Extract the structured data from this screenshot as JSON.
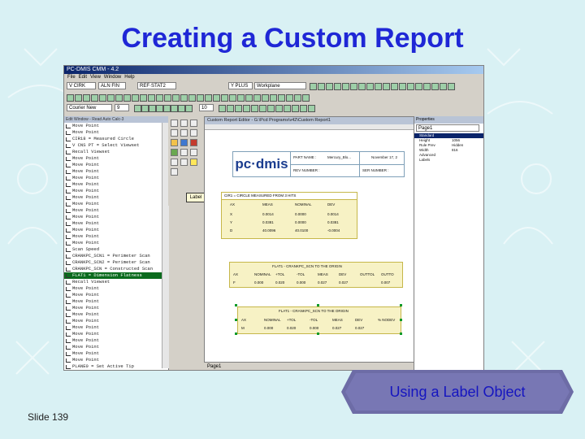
{
  "slide": {
    "title": "Creating a Custom Report",
    "callout": "Using a Label Object",
    "number": "Slide 139"
  },
  "app": {
    "window_title": "PC-DMIS CMM - 4.2",
    "menu": [
      "File",
      "Edit",
      "View",
      "Window",
      "Help"
    ],
    "combo1": "V CIRK",
    "combo2": "ALN FIN",
    "combo3": "REF·STAT2",
    "combo4": "Y PLUS",
    "combo5": "Workplane",
    "font_combo": "Courier New",
    "size_combo": "9",
    "zoom_combo": "10"
  },
  "edit_window": {
    "title": "Edit Window - Read Auto Calc-3",
    "lines": [
      {
        "text": "Move Point",
        "selected": false
      },
      {
        "text": "Move Point",
        "selected": false
      },
      {
        "text": "CIR18 = Measured Circle",
        "selected": false
      },
      {
        "text": "V CNS PT = Select Viewset",
        "selected": false
      },
      {
        "text": "Recall Viewset",
        "selected": false
      },
      {
        "text": "Move Point",
        "selected": false
      },
      {
        "text": "Move Point",
        "selected": false
      },
      {
        "text": "Move Point",
        "selected": false
      },
      {
        "text": "Move Point",
        "selected": false
      },
      {
        "text": "Move Point",
        "selected": false
      },
      {
        "text": "Move Point",
        "selected": false
      },
      {
        "text": "Move Point",
        "selected": false
      },
      {
        "text": "Move Point",
        "selected": false
      },
      {
        "text": "Move Point",
        "selected": false
      },
      {
        "text": "Move Point",
        "selected": false
      },
      {
        "text": "Move Point",
        "selected": false
      },
      {
        "text": "Move Point",
        "selected": false
      },
      {
        "text": "Move Point",
        "selected": false
      },
      {
        "text": "Move Point",
        "selected": false
      },
      {
        "text": "Scan Speed",
        "selected": false
      },
      {
        "text": "CRANKPC_SCN1 = Perimeter Scan",
        "selected": false
      },
      {
        "text": "CRANKPC_SCN2 = Perimeter Scan",
        "selected": false
      },
      {
        "text": "CRANKPC_SCN = Constructed Scan",
        "selected": false
      },
      {
        "text": "FLAT1 = Dimension Flatness",
        "selected": true
      },
      {
        "text": "Recall Viewset",
        "selected": false
      },
      {
        "text": "Move Point",
        "selected": false
      },
      {
        "text": "Move Point",
        "selected": false
      },
      {
        "text": "Move Point",
        "selected": false
      },
      {
        "text": "Move Point",
        "selected": false
      },
      {
        "text": "Move Point",
        "selected": false
      },
      {
        "text": "Move Point",
        "selected": false
      },
      {
        "text": "Move Point",
        "selected": false
      },
      {
        "text": "Move Point",
        "selected": false
      },
      {
        "text": "Move Point",
        "selected": false
      },
      {
        "text": "Move Point",
        "selected": false
      },
      {
        "text": "Move Point",
        "selected": false
      },
      {
        "text": "Move Point",
        "selected": false
      },
      {
        "text": "PLANE0 = Set Active Tip",
        "selected": false
      },
      {
        "text": "Set Active Workplane",
        "selected": false
      },
      {
        "text": "Move Point",
        "selected": false
      }
    ]
  },
  "report": {
    "title": "Custom Report Editor - G:\\Pcd Programs\\v42\\Custom Report1",
    "logo": "pc·dmis",
    "part_name_label": "PART NAME :",
    "part_name_value": "Mercury_Blo...",
    "date_value": "November 17, 2",
    "rev_label": "REV NUMBER :",
    "ser_label": "SER NUMBER :",
    "cir_title": "CIR1 = CIRCLE MEASURED FROM 3 HITS",
    "cir_headers": [
      "AX",
      "MEAS",
      "NOMINAL",
      "DEV"
    ],
    "cir_rows": [
      [
        "X",
        "0.0014",
        "0.0000",
        "0.0014"
      ],
      [
        "Y",
        "0.0381",
        "0.0000",
        "0.0381"
      ],
      [
        "D",
        "40.0096",
        "40.0100",
        "-0.0004"
      ]
    ],
    "flat1_title": "FLAT1 - CRANKPC_SCN TO THE ORIGIN",
    "flat1_headers": [
      "AX",
      "NOMINAL",
      "+TOL",
      "-TOL",
      "MEAS",
      "DEV",
      "OUTTOL",
      "OUTTO"
    ],
    "flat1_row": [
      "F",
      "0.000",
      "0.020",
      "0.000",
      "0.027",
      "0.027",
      "",
      "0.007"
    ],
    "flat2_title": "FLAT1 - CRANKPC_SCN TO THE ORIGIN",
    "flat2_headers": [
      "AX",
      "NOMINAL",
      "+TOL",
      "-TOL",
      "MEAS",
      "DEV",
      "% NODEV"
    ],
    "flat2_row": [
      "M",
      "0.000",
      "0.020",
      "0.000",
      "0.027",
      "0.027",
      ""
    ],
    "label_tool": "Label",
    "page_tab": "Page1"
  },
  "properties": {
    "title": "Properties",
    "combo": "Page1",
    "section": "Standard",
    "rows": [
      {
        "k": "Height",
        "v": "1056"
      },
      {
        "k": "Rule Prev",
        "v": "Hidden"
      },
      {
        "k": "Width",
        "v": "816"
      }
    ],
    "advanced": "Advanced",
    "labels": "Labels"
  },
  "colors": {
    "title": "#1f27d6",
    "callout_text": "#1515c0",
    "callout_bg": "#6b6aa8"
  }
}
